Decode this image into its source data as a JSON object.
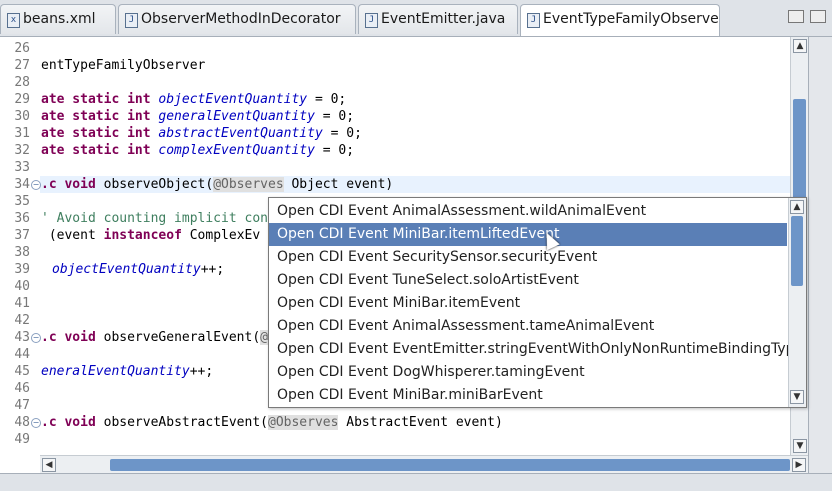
{
  "tabs": [
    {
      "label": "beans.xml",
      "icon": "xml-file-icon",
      "icon_glyph": "x"
    },
    {
      "label": "ObserverMethodInDecorator",
      "icon": "java-file-icon",
      "icon_glyph": "J"
    },
    {
      "label": "EventEmitter.java",
      "icon": "java-file-icon",
      "icon_glyph": "J"
    },
    {
      "label": "EventTypeFamilyObserver.j",
      "icon": "java-file-icon",
      "icon_glyph": "J",
      "active": true
    }
  ],
  "window_controls": [
    "minimize-icon",
    "maximize-icon"
  ],
  "editor": {
    "line_numbers": [
      "26",
      "27",
      "28",
      "29",
      "30",
      "31",
      "32",
      "33",
      "34",
      "35",
      "36",
      "37",
      "38",
      "39",
      "40",
      "41",
      "42",
      "43",
      "44",
      "45",
      "46",
      "47",
      "48",
      "49"
    ],
    "lines": {
      "l27": "entTypeFamilyObserver",
      "l29_kw": "ate static int ",
      "l29_fld": "objectEventQuantity",
      "l29_rest": " = 0;",
      "l30_kw": "ate static int ",
      "l30_fld": "generalEventQuantity",
      "l30_rest": " = 0;",
      "l31_kw": "ate static int ",
      "l31_fld": "abstractEventQuantity",
      "l31_rest": " = 0;",
      "l32_kw": "ate static int ",
      "l32_fld": "complexEventQuantity",
      "l32_rest": " = 0;",
      "l34_kw": ".c void ",
      "l34_a": "observeObject(",
      "l34_ann": "@Observes",
      "l34_b": " Object event)",
      "l36_cmt": "' Avoid counting implicit con",
      "l37_a": " (event ",
      "l37_kw": "instanceof",
      "l37_b": " ComplexEv",
      "l39_fld": "objectEventQuantity",
      "l39_rest": "++;",
      "l43_kw": ".c void ",
      "l43_a": "observeGeneralEvent(",
      "l43_ann": "@",
      "l45_fld": "eneralEventQuantity",
      "l45_rest": "++;",
      "l47_kw": ".c void ",
      "l47_a": "observeAbstractEvent(",
      "l47_ann": "@Observes",
      "l47_b": " AbstractEvent event)"
    }
  },
  "popup": {
    "selected_index": 1,
    "items": [
      "Open CDI Event AnimalAssessment.wildAnimalEvent",
      "Open CDI Event MiniBar.itemLiftedEvent",
      "Open CDI Event SecuritySensor.securityEvent",
      "Open CDI Event TuneSelect.soloArtistEvent",
      "Open CDI Event MiniBar.itemEvent",
      "Open CDI Event AnimalAssessment.tameAnimalEvent",
      "Open CDI Event EventEmitter.stringEventWithOnlyNonRuntimeBindingType",
      "Open CDI Event DogWhisperer.tamingEvent",
      "Open CDI Event MiniBar.miniBarEvent"
    ]
  },
  "colors": {
    "selection": "#5a7fb6",
    "scroll_thumb": "#6d95c8",
    "keyword": "#7f0055",
    "field": "#0000c0",
    "comment": "#3f7f5f"
  }
}
